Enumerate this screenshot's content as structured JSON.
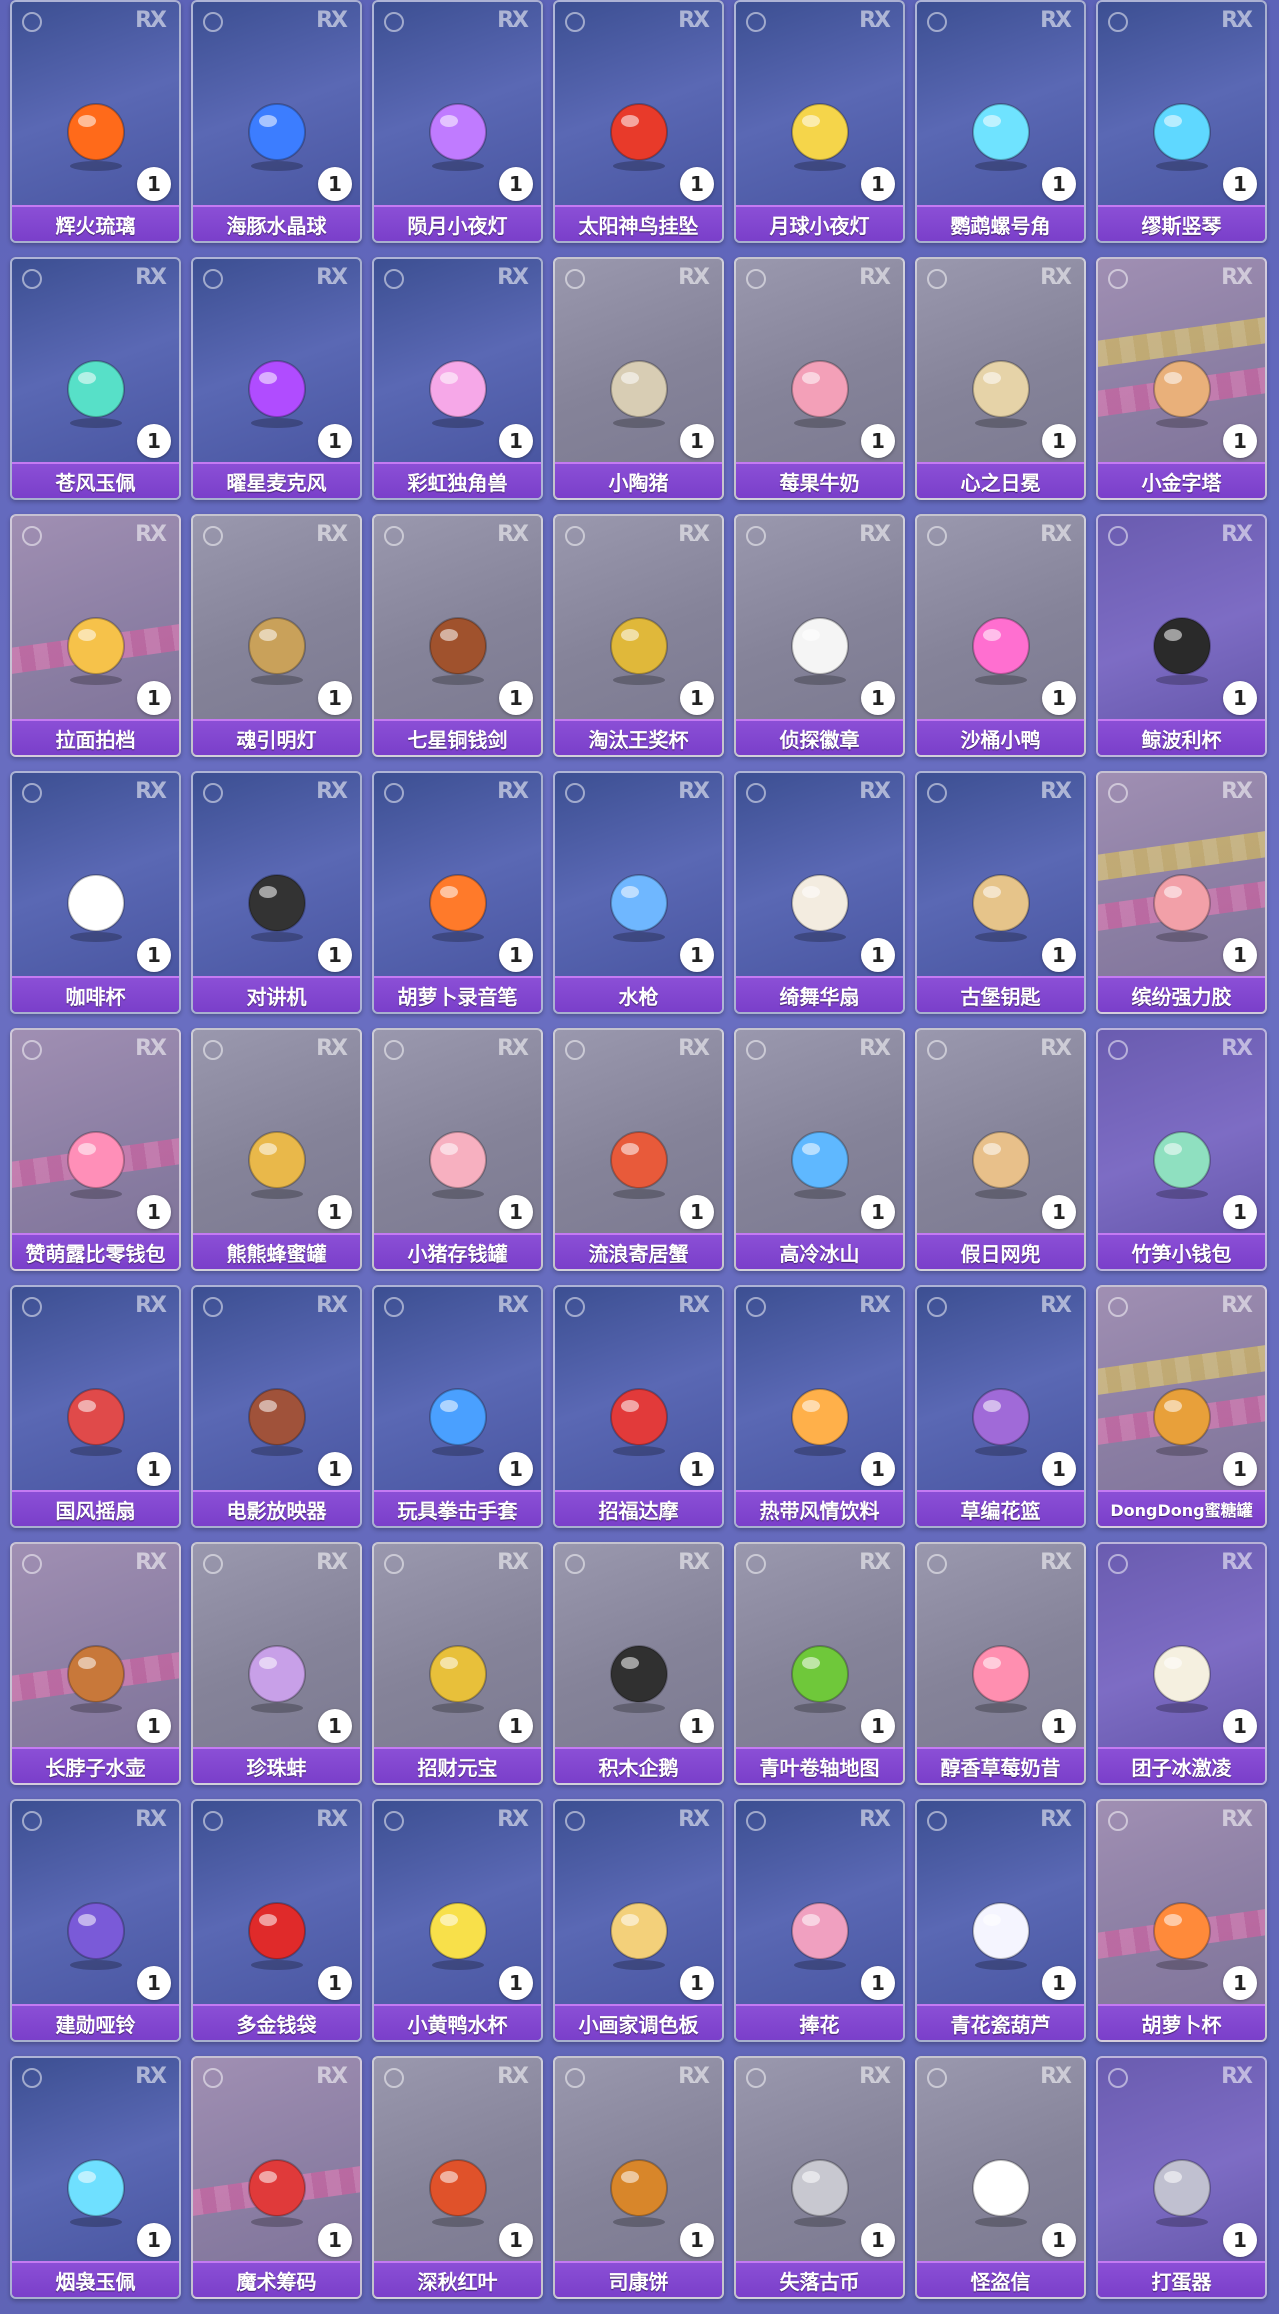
{
  "grid": {
    "items": [
      {
        "name": "辉火琉璃",
        "count": "1",
        "icon": "flame-flower-icon",
        "color": "#ff6a1a",
        "bg": "blue"
      },
      {
        "name": "海豚水晶球",
        "count": "1",
        "icon": "crystal-ball-icon",
        "color": "#3c7dff",
        "bg": "blue"
      },
      {
        "name": "陨月小夜灯",
        "count": "1",
        "icon": "whale-lamp-icon",
        "color": "#c07bff",
        "bg": "blue"
      },
      {
        "name": "太阳神鸟挂坠",
        "count": "1",
        "icon": "sun-pendant-icon",
        "color": "#e83a2a",
        "bg": "blue"
      },
      {
        "name": "月球小夜灯",
        "count": "1",
        "icon": "moon-lamp-icon",
        "color": "#f5d54a",
        "bg": "blue"
      },
      {
        "name": "鹦鹉螺号角",
        "count": "1",
        "icon": "nautilus-horn-icon",
        "color": "#6fe3ff",
        "bg": "blue"
      },
      {
        "name": "缪斯竖琴",
        "count": "1",
        "icon": "harp-icon",
        "color": "#5fd8ff",
        "bg": "blue"
      },
      {
        "name": "苍风玉佩",
        "count": "1",
        "icon": "jade-pendant-icon",
        "color": "#57e0c8",
        "bg": "blue"
      },
      {
        "name": "曜星麦克风",
        "count": "1",
        "icon": "microphone-icon",
        "color": "#b04cff",
        "bg": "blue"
      },
      {
        "name": "彩虹独角兽",
        "count": "1",
        "icon": "unicorn-icon",
        "color": "#f6a8e8",
        "bg": "blue"
      },
      {
        "name": "小陶猪",
        "count": "1",
        "icon": "clay-pig-icon",
        "color": "#d8cdb4",
        "bg": "gray"
      },
      {
        "name": "莓果牛奶",
        "count": "1",
        "icon": "milk-bottle-icon",
        "color": "#f3a0b8",
        "bg": "gray"
      },
      {
        "name": "心之日冕",
        "count": "1",
        "icon": "sun-crown-icon",
        "color": "#e6d3a8",
        "bg": "gray"
      },
      {
        "name": "小金字塔",
        "count": "1",
        "icon": "pyramid-icon",
        "color": "#e9b07a",
        "bg": "pink"
      },
      {
        "name": "拉面拍档",
        "count": "1",
        "icon": "ramen-buddy-icon",
        "color": "#f6c24a",
        "bg": "pink"
      },
      {
        "name": "魂引明灯",
        "count": "1",
        "icon": "lantern-icon",
        "color": "#c9a15a",
        "bg": "gray"
      },
      {
        "name": "七星铜钱剑",
        "count": "1",
        "icon": "coin-sword-icon",
        "color": "#a0522d",
        "bg": "gray"
      },
      {
        "name": "淘汰王奖杯",
        "count": "1",
        "icon": "trophy-icon",
        "color": "#e0b83a",
        "bg": "gray"
      },
      {
        "name": "侦探徽章",
        "count": "1",
        "icon": "glasses-icon",
        "color": "#f5f5f5",
        "bg": "gray"
      },
      {
        "name": "沙桶小鸭",
        "count": "1",
        "icon": "heart-glasses-icon",
        "color": "#ff6fd0",
        "bg": "gray"
      },
      {
        "name": "鲸波利杯",
        "count": "1",
        "icon": "orca-cup-icon",
        "color": "#2a2a2a",
        "bg": "purple"
      },
      {
        "name": "咖啡杯",
        "count": "1",
        "icon": "coffee-mug-icon",
        "color": "#ffffff",
        "bg": "blue"
      },
      {
        "name": "对讲机",
        "count": "1",
        "icon": "walkie-talkie-icon",
        "color": "#333333",
        "bg": "blue"
      },
      {
        "name": "胡萝卜录音笔",
        "count": "1",
        "icon": "carrot-recorder-icon",
        "color": "#ff7a2a",
        "bg": "blue"
      },
      {
        "name": "水枪",
        "count": "1",
        "icon": "water-gun-icon",
        "color": "#6fb7ff",
        "bg": "blue"
      },
      {
        "name": "绮舞华扇",
        "count": "1",
        "icon": "fan-icon",
        "color": "#f3ece0",
        "bg": "blue"
      },
      {
        "name": "古堡钥匙",
        "count": "1",
        "icon": "key-icon",
        "color": "#e6c48a",
        "bg": "blue"
      },
      {
        "name": "缤纷强力胶",
        "count": "1",
        "icon": "glue-bottle-icon",
        "color": "#f2a0a8",
        "bg": "pink"
      },
      {
        "name": "赞萌露比零钱包",
        "count": "1",
        "icon": "pink-purse-icon",
        "color": "#ff8fb8",
        "bg": "pink"
      },
      {
        "name": "熊熊蜂蜜罐",
        "count": "1",
        "icon": "honey-jar-icon",
        "color": "#e9b84a",
        "bg": "gray"
      },
      {
        "name": "小猪存钱罐",
        "count": "1",
        "icon": "piggy-bank-icon",
        "color": "#f7b0c0",
        "bg": "gray"
      },
      {
        "name": "流浪寄居蟹",
        "count": "1",
        "icon": "hermit-crab-icon",
        "color": "#e85a3a",
        "bg": "gray"
      },
      {
        "name": "高冷冰山",
        "count": "1",
        "icon": "iceberg-icon",
        "color": "#5fb8ff",
        "bg": "gray"
      },
      {
        "name": "假日网兜",
        "count": "1",
        "icon": "net-icon",
        "color": "#e8c08a",
        "bg": "gray"
      },
      {
        "name": "竹笋小钱包",
        "count": "1",
        "icon": "bamboo-purse-icon",
        "color": "#8fe0c0",
        "bg": "purple"
      },
      {
        "name": "国风摇扇",
        "count": "1",
        "icon": "round-fan-icon",
        "color": "#e04a4a",
        "bg": "blue"
      },
      {
        "name": "电影放映器",
        "count": "1",
        "icon": "projector-icon",
        "color": "#a0523a",
        "bg": "blue"
      },
      {
        "name": "玩具拳击手套",
        "count": "1",
        "icon": "boxing-toy-icon",
        "color": "#4aa0ff",
        "bg": "blue"
      },
      {
        "name": "招福达摩",
        "count": "1",
        "icon": "daruma-icon",
        "color": "#e23a3a",
        "bg": "blue"
      },
      {
        "name": "热带风情饮料",
        "count": "1",
        "icon": "tropical-drink-icon",
        "color": "#ffb04a",
        "bg": "blue"
      },
      {
        "name": "草编花篮",
        "count": "1",
        "icon": "flower-basket-icon",
        "color": "#a06ad8",
        "bg": "blue"
      },
      {
        "name": "DongDong蜜糖罐",
        "count": "1",
        "icon": "honey-pot-icon",
        "color": "#e8a03a",
        "bg": "pink"
      },
      {
        "name": "长脖子水壶",
        "count": "1",
        "icon": "giraffe-bottle-icon",
        "color": "#c8783a",
        "bg": "pink"
      },
      {
        "name": "珍珠蚌",
        "count": "1",
        "icon": "pearl-clam-icon",
        "color": "#c8a0e8",
        "bg": "gray"
      },
      {
        "name": "招财元宝",
        "count": "1",
        "icon": "gold-ingot-icon",
        "color": "#e8c03a",
        "bg": "gray"
      },
      {
        "name": "积木企鹅",
        "count": "1",
        "icon": "block-penguin-icon",
        "color": "#303030",
        "bg": "gray"
      },
      {
        "name": "青叶卷轴地图",
        "count": "1",
        "icon": "leaf-scroll-icon",
        "color": "#6fc83a",
        "bg": "gray"
      },
      {
        "name": "醇香草莓奶昔",
        "count": "1",
        "icon": "milkshake-icon",
        "color": "#ff8fb0",
        "bg": "gray"
      },
      {
        "name": "团子冰激凌",
        "count": "1",
        "icon": "ice-cream-icon",
        "color": "#f5f0e0",
        "bg": "purple"
      },
      {
        "name": "建勋哑铃",
        "count": "1",
        "icon": "dumbbell-icon",
        "color": "#7a5ad8",
        "bg": "blue"
      },
      {
        "name": "多金钱袋",
        "count": "1",
        "icon": "money-bag-icon",
        "color": "#e02a2a",
        "bg": "blue"
      },
      {
        "name": "小黄鸭水杯",
        "count": "1",
        "icon": "duck-cup-icon",
        "color": "#f8e04a",
        "bg": "blue"
      },
      {
        "name": "小画家调色板",
        "count": "1",
        "icon": "palette-icon",
        "color": "#f3d07a",
        "bg": "blue"
      },
      {
        "name": "捧花",
        "count": "1",
        "icon": "bouquet-icon",
        "color": "#f0a0c0",
        "bg": "blue"
      },
      {
        "name": "青花瓷葫芦",
        "count": "1",
        "icon": "porcelain-gourd-icon",
        "color": "#f5f5ff",
        "bg": "blue"
      },
      {
        "name": "胡萝卜杯",
        "count": "1",
        "icon": "carrot-cup-icon",
        "color": "#ff8a3a",
        "bg": "pink"
      },
      {
        "name": "烟袅玉佩",
        "count": "1",
        "icon": "smoke-jade-icon",
        "color": "#6fe0ff",
        "bg": "blue"
      },
      {
        "name": "魔术筹码",
        "count": "1",
        "icon": "poker-chip-icon",
        "color": "#e03a3a",
        "bg": "pink"
      },
      {
        "name": "深秋红叶",
        "count": "1",
        "icon": "maple-leaf-icon",
        "color": "#e0522a",
        "bg": "gray"
      },
      {
        "name": "司康饼",
        "count": "1",
        "icon": "scone-icon",
        "color": "#d8862a",
        "bg": "gray"
      },
      {
        "name": "失落古币",
        "count": "1",
        "icon": "ancient-coin-icon",
        "color": "#c8c8d0",
        "bg": "gray"
      },
      {
        "name": "怪盗信",
        "count": "1",
        "icon": "phantom-letter-icon",
        "color": "#ffffff",
        "bg": "gray"
      },
      {
        "name": "打蛋器",
        "count": "1",
        "icon": "whisk-icon",
        "color": "#c0c0d0",
        "bg": "purple"
      }
    ]
  },
  "watermark": "RX"
}
